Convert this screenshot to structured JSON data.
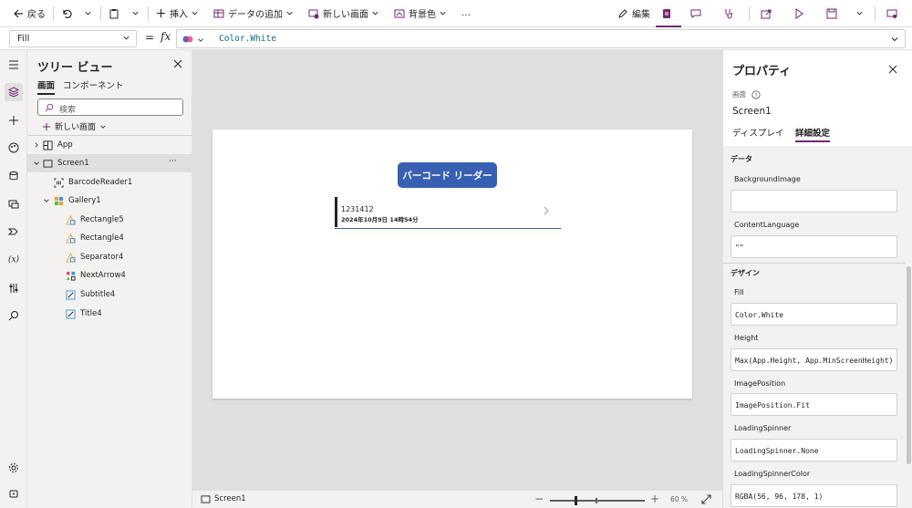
{
  "toolbar": {
    "back": "戻る",
    "insert": "挿入",
    "add_data": "データの追加",
    "new_screen": "新しい画面",
    "bg_color": "背景色",
    "more": "…",
    "edit": "編集"
  },
  "formula": {
    "property": "Fill",
    "value": "Color.White"
  },
  "tree": {
    "title": "ツリー ビュー",
    "tab_screens": "画面",
    "tab_components": "コンポーネント",
    "search_placeholder": "検索",
    "new_screen": "新しい画面",
    "items": [
      {
        "label": "App"
      },
      {
        "label": "Screen1",
        "more": "···"
      },
      {
        "label": "BarcodeReader1"
      },
      {
        "label": "Gallery1"
      },
      {
        "label": "Rectangle5"
      },
      {
        "label": "Rectangle4"
      },
      {
        "label": "Separator4"
      },
      {
        "label": "NextArrow4"
      },
      {
        "label": "Subtitle4"
      },
      {
        "label": "Title4"
      }
    ]
  },
  "canvas": {
    "button_label": "バーコード リーダー",
    "gallery_title": "1231412",
    "gallery_subtitle": "2024年10月9日 14時54分"
  },
  "status": {
    "screen": "Screen1",
    "zoom": "60 %",
    "zoom_level": 60
  },
  "props": {
    "title": "プロパティ",
    "type": "画面",
    "name": "Screen1",
    "tab_display": "ディスプレイ",
    "tab_advanced": "詳細設定",
    "section_data": "データ",
    "section_design": "デザイン",
    "fields": [
      {
        "label": "BackgroundImage",
        "value": ""
      },
      {
        "label": "ContentLanguage",
        "value": "\"\""
      },
      {
        "label": "Fill",
        "value": "Color.White"
      },
      {
        "label": "Height",
        "value": "Max(App.Height, App.MinScreenHeight)"
      },
      {
        "label": "ImagePosition",
        "value": "ImagePosition.Fit"
      },
      {
        "label": "LoadingSpinner",
        "value": "LoadingSpinner.None"
      },
      {
        "label": "LoadingSpinnerColor",
        "value": "RGBA(56, 96, 178, 1)"
      }
    ]
  },
  "colors": {
    "accent": "#742774",
    "button": "#3860b2"
  }
}
